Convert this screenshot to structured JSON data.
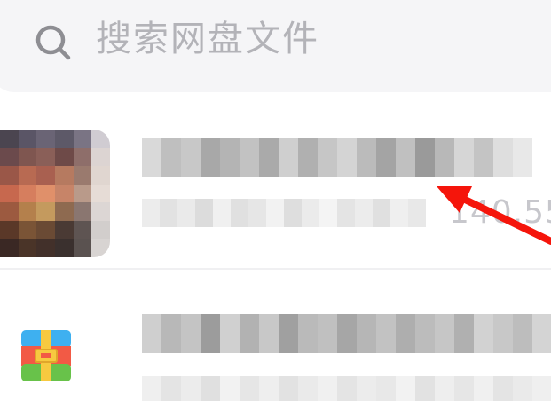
{
  "search": {
    "placeholder": "搜索网盘文件",
    "icon": "search-icon"
  },
  "files": [
    {
      "thumbnail": "image-thumbnail",
      "name": "",
      "meta": "",
      "size": "140.55"
    },
    {
      "thumbnail": "archive-icon",
      "name": "",
      "meta": ""
    }
  ],
  "colors": {
    "search_bg": "#f5f5f7",
    "placeholder": "#b3b3b8",
    "arrow": "#f5150b",
    "archive_top": "#3eb0f0",
    "archive_mid": "#f25a45",
    "archive_bottom": "#68c24a",
    "archive_buckle": "#f7c940"
  }
}
